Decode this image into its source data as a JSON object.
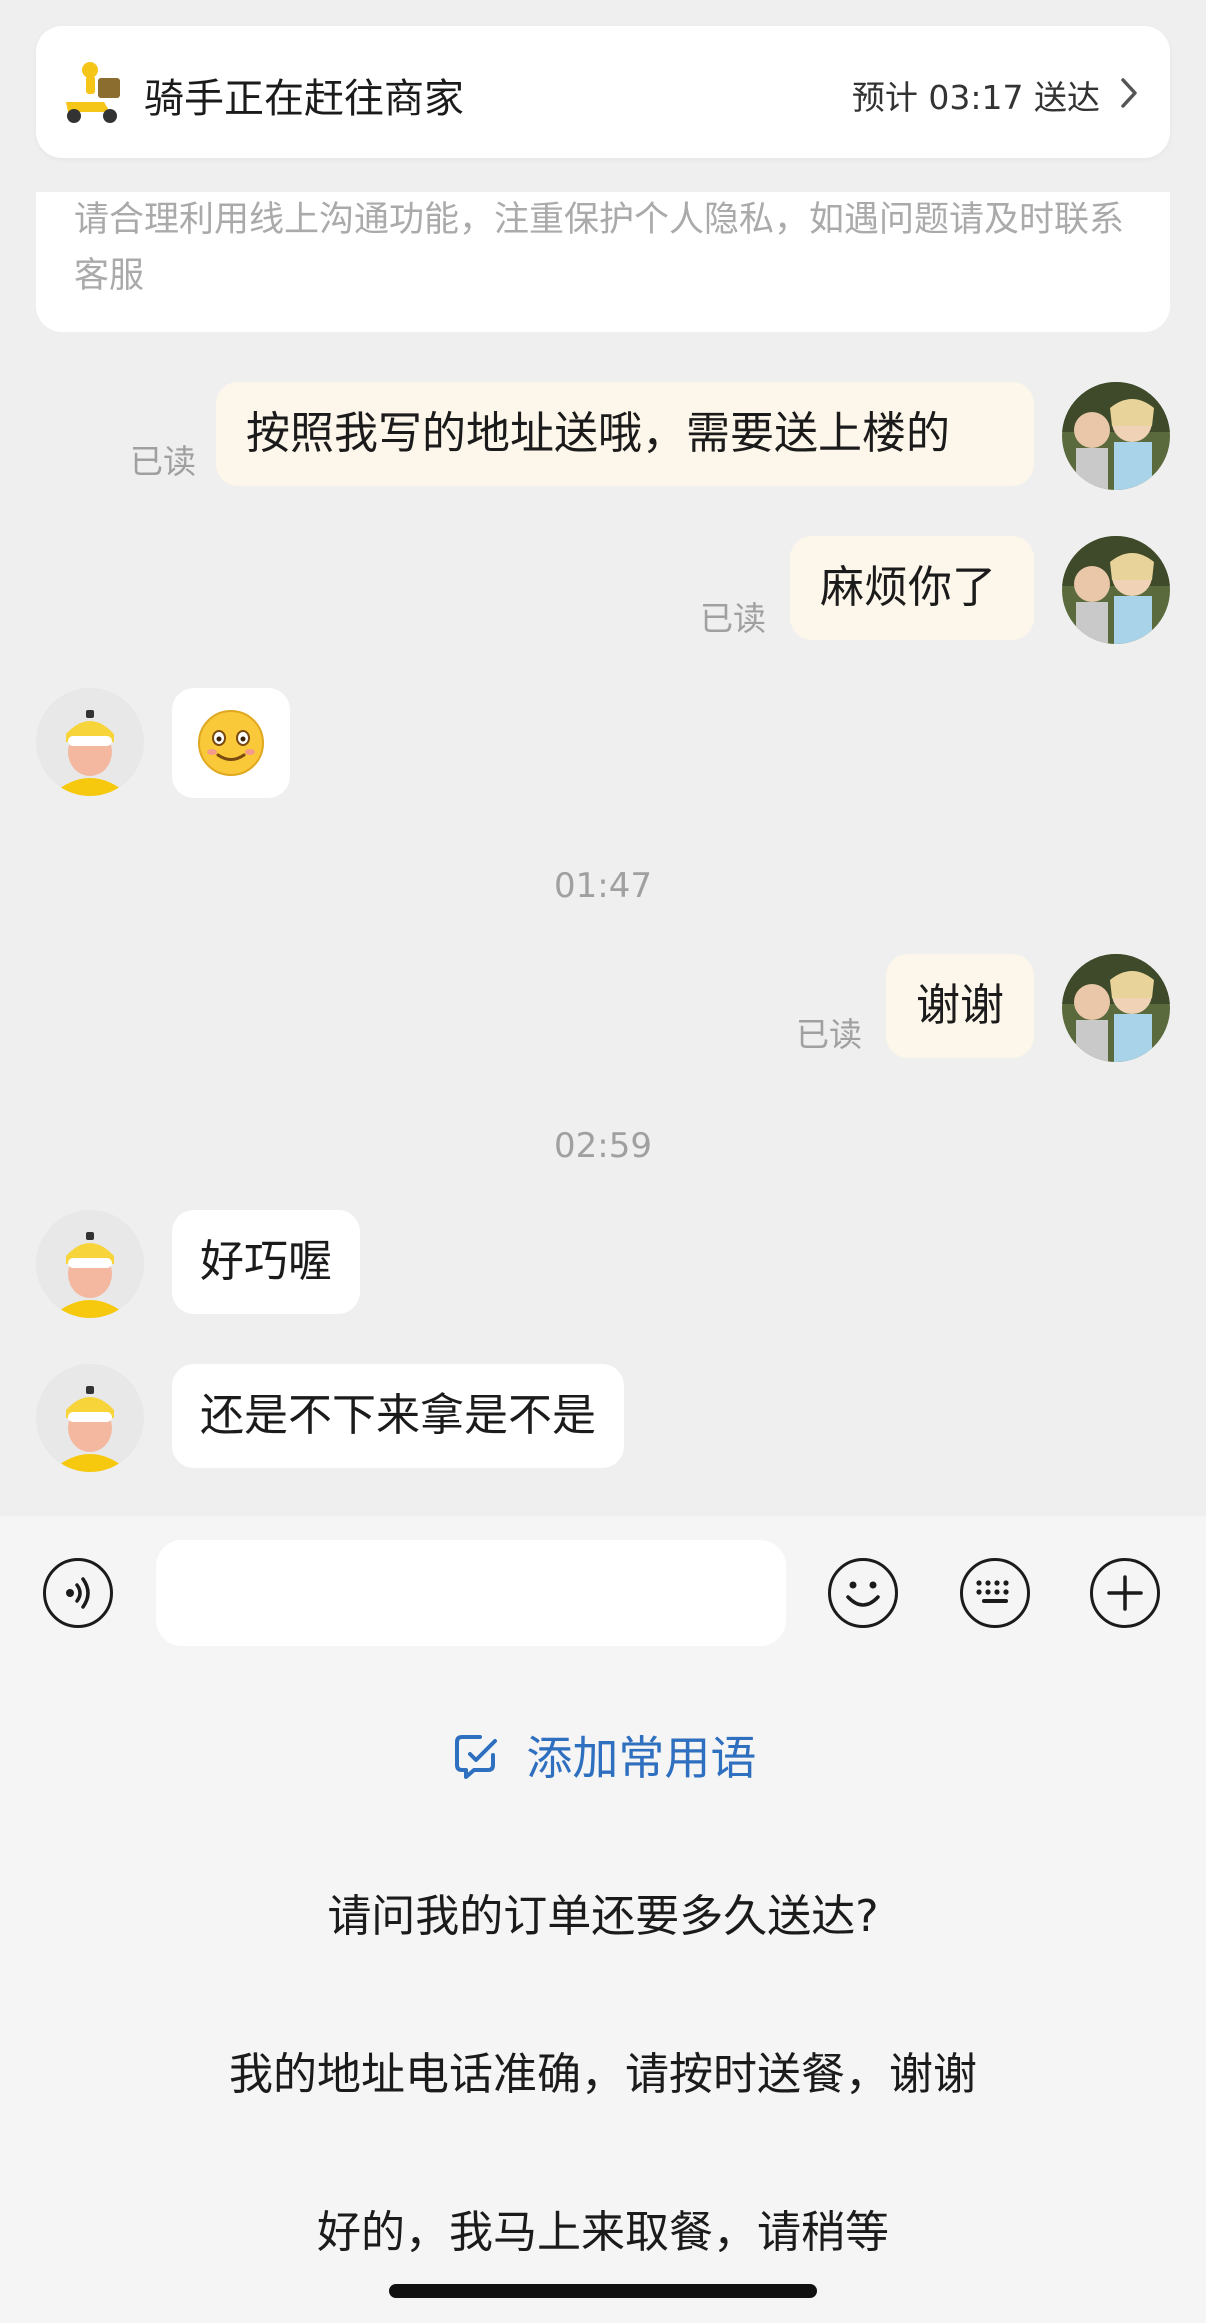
{
  "header": {
    "status_title": "骑手正在赶往商家",
    "eta": "预计 03:17 送达"
  },
  "notice": {
    "text": "请合理利用线上沟通功能，注重保护个人隐私，如遇问题请及时联系客服"
  },
  "messages": [
    {
      "from": "me",
      "text": "按照我写的地址送哦，需要送上楼的",
      "status": "已读"
    },
    {
      "from": "me",
      "text": "麻烦你了",
      "status": "已读"
    },
    {
      "from": "rider",
      "emoji": "smile-emoji"
    },
    {
      "time": "01:47"
    },
    {
      "from": "me",
      "text": "谢谢",
      "status": "已读"
    },
    {
      "time": "02:59"
    },
    {
      "from": "rider",
      "text": "好巧喔"
    },
    {
      "from": "rider",
      "text": "还是不下来拿是不是"
    }
  ],
  "input": {
    "value": "",
    "placeholder": ""
  },
  "quick_replies": {
    "add_label": "添加常用语",
    "items": [
      "请问我的订单还要多久送达?",
      "我的地址电话准确，请按时送餐，谢谢",
      "好的，我马上来取餐，请稍等"
    ]
  },
  "colors": {
    "background": "#efefef",
    "my_bubble": "#fdf6ea",
    "other_bubble": "#ffffff",
    "accent_link": "#2f6fbf",
    "muted_text": "#a0a0a0"
  }
}
